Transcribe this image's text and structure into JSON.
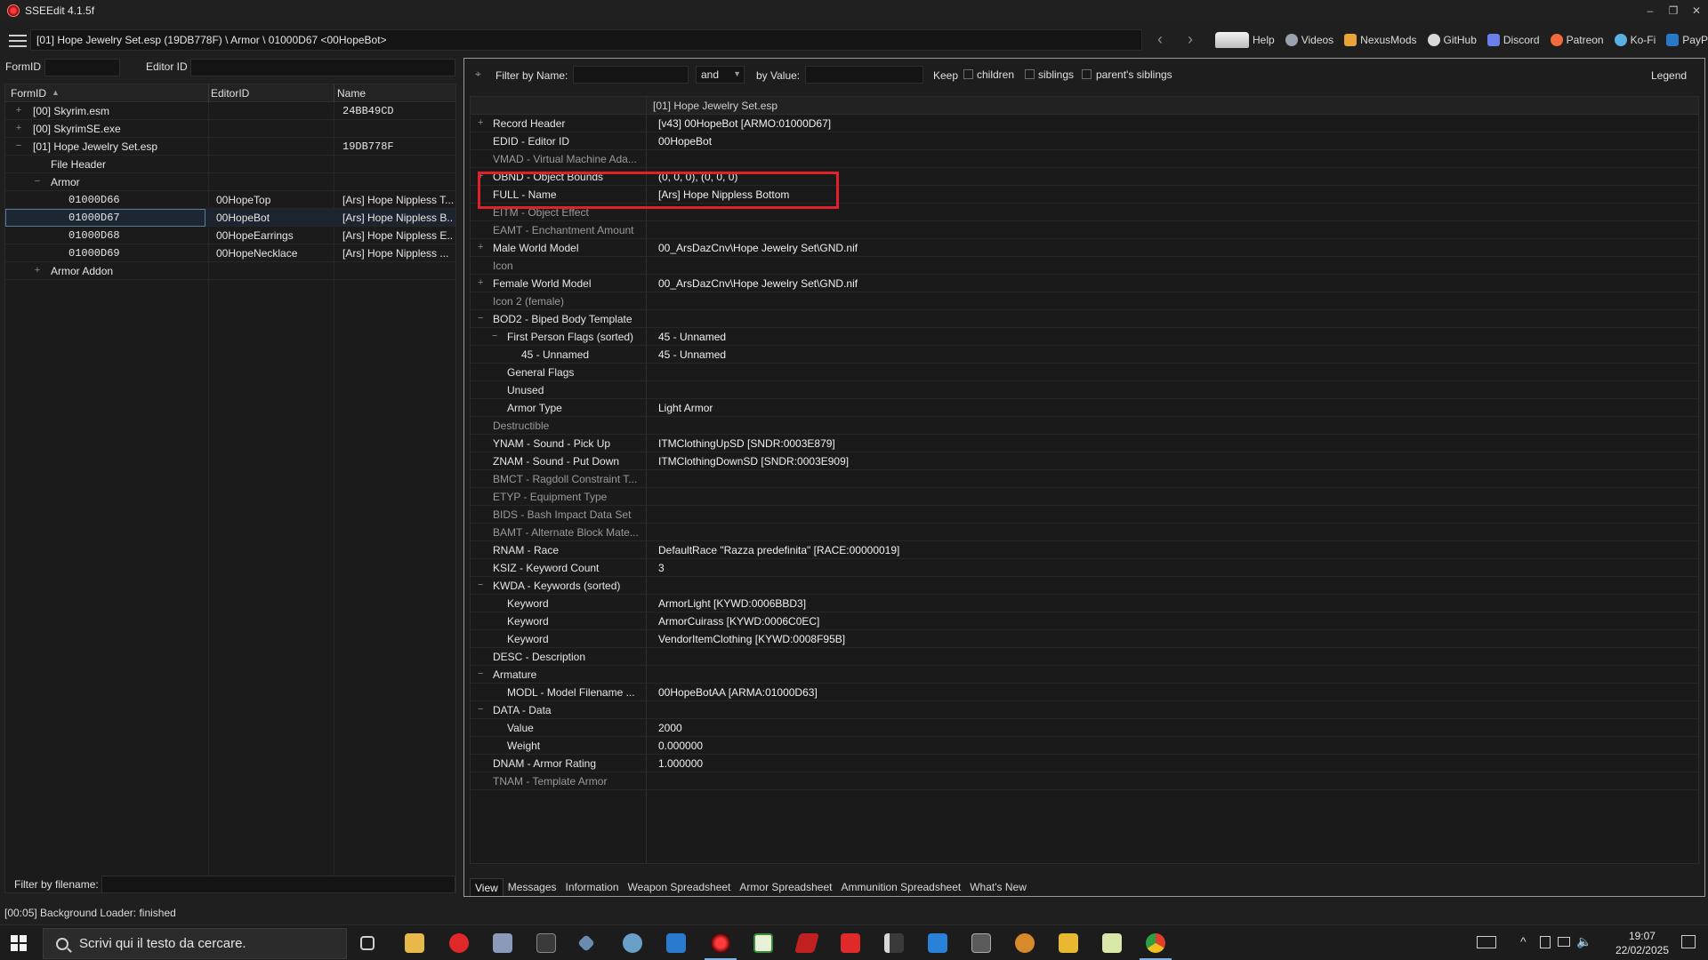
{
  "window": {
    "title": "SSEEdit 4.1.5f",
    "controls": [
      "–",
      "❐",
      "✕"
    ]
  },
  "pathbar": {
    "path": "[01] Hope Jewelry Set.esp (19DB778F) \\ Armor \\ 01000D67 <00HopeBot>",
    "links": [
      "Help",
      "Videos",
      "NexusMods",
      "GitHub",
      "Discord",
      "Patreon",
      "Ko-Fi",
      "PayPal"
    ]
  },
  "left": {
    "formid_label": "FormID",
    "editorid_label": "Editor ID",
    "columns": [
      "FormID",
      "EditorID",
      "Name"
    ],
    "rows": [
      {
        "exp": "+",
        "indent": 0,
        "formid": "[00] Skyrim.esm",
        "editorid": "",
        "name": "24BB49CD",
        "mono": false
      },
      {
        "exp": "+",
        "indent": 0,
        "formid": "[00] SkyrimSE.exe",
        "editorid": "",
        "name": "",
        "mono": false
      },
      {
        "exp": "−",
        "indent": 0,
        "formid": "[01] Hope Jewelry Set.esp",
        "editorid": "",
        "name": "19DB778F",
        "mono": false
      },
      {
        "exp": "",
        "indent": 1,
        "formid": "File Header",
        "editorid": "",
        "name": "",
        "mono": false
      },
      {
        "exp": "−",
        "indent": 1,
        "formid": "Armor",
        "editorid": "",
        "name": "",
        "mono": false
      },
      {
        "exp": "",
        "indent": 2,
        "formid": "01000D66",
        "editorid": "00HopeTop",
        "name": "[Ars] Hope Nippless T...",
        "mono": true
      },
      {
        "exp": "",
        "indent": 2,
        "formid": "01000D67",
        "editorid": "00HopeBot",
        "name": "[Ars] Hope Nippless B...",
        "mono": true,
        "selected": true
      },
      {
        "exp": "",
        "indent": 2,
        "formid": "01000D68",
        "editorid": "00HopeEarrings",
        "name": "[Ars] Hope Nippless E...",
        "mono": true
      },
      {
        "exp": "",
        "indent": 2,
        "formid": "01000D69",
        "editorid": "00HopeNecklace",
        "name": "[Ars] Hope Nippless ...",
        "mono": true
      },
      {
        "exp": "+",
        "indent": 1,
        "formid": "Armor Addon",
        "editorid": "",
        "name": "",
        "mono": false
      }
    ],
    "filter_filename_label": "Filter by filename:"
  },
  "right": {
    "filter_name_label": "Filter by Name:",
    "and_value": "and",
    "by_value_label": "by Value:",
    "keep_label": "Keep",
    "children_label": "children",
    "siblings_label": "siblings",
    "parents_siblings_label": "parent's siblings",
    "legend_label": "Legend",
    "grid_header": "[01] Hope Jewelry Set.esp",
    "rows": [
      {
        "exp": "+",
        "level": 0,
        "name": "Record Header",
        "value": "[v43] 00HopeBot [ARMO:01000D67]"
      },
      {
        "exp": "",
        "level": 0,
        "name": "EDID - Editor ID",
        "value": "00HopeBot"
      },
      {
        "exp": "",
        "level": 0,
        "name": "VMAD - Virtual Machine Ada...",
        "value": "",
        "dim": true
      },
      {
        "exp": "+",
        "level": 0,
        "name": "OBND - Object Bounds",
        "value": "(0, 0, 0), (0, 0, 0)"
      },
      {
        "exp": "",
        "level": 0,
        "name": "FULL - Name",
        "value": "[Ars] Hope Nippless Bottom"
      },
      {
        "exp": "",
        "level": 0,
        "name": "EITM - Object Effect",
        "value": "",
        "dim": true
      },
      {
        "exp": "",
        "level": 0,
        "name": "EAMT - Enchantment Amount",
        "value": "",
        "dim": true
      },
      {
        "exp": "+",
        "level": 0,
        "name": "Male World Model",
        "value": "00_ArsDazCnv\\Hope Jewelry Set\\GND.nif"
      },
      {
        "exp": "",
        "level": 0,
        "name": "Icon",
        "value": "",
        "dim": true
      },
      {
        "exp": "+",
        "level": 0,
        "name": "Female World Model",
        "value": "00_ArsDazCnv\\Hope Jewelry Set\\GND.nif"
      },
      {
        "exp": "",
        "level": 0,
        "name": "Icon 2 (female)",
        "value": "",
        "dim": true
      },
      {
        "exp": "−",
        "level": 0,
        "name": "BOD2 - Biped Body Template",
        "value": ""
      },
      {
        "exp": "−",
        "level": 1,
        "name": "First Person Flags (sorted)",
        "value": "45 - Unnamed"
      },
      {
        "exp": "",
        "level": 2,
        "name": "45 - Unnamed",
        "value": "45 - Unnamed"
      },
      {
        "exp": "",
        "level": 1,
        "name": "General Flags",
        "value": ""
      },
      {
        "exp": "",
        "level": 1,
        "name": "Unused",
        "value": ""
      },
      {
        "exp": "",
        "level": 1,
        "name": "Armor Type",
        "value": "Light Armor"
      },
      {
        "exp": "",
        "level": 0,
        "name": "Destructible",
        "value": "",
        "dim": true
      },
      {
        "exp": "",
        "level": 0,
        "name": "YNAM - Sound - Pick Up",
        "value": "ITMClothingUpSD [SNDR:0003E879]"
      },
      {
        "exp": "",
        "level": 0,
        "name": "ZNAM - Sound - Put Down",
        "value": "ITMClothingDownSD [SNDR:0003E909]"
      },
      {
        "exp": "",
        "level": 0,
        "name": "BMCT - Ragdoll Constraint T...",
        "value": "",
        "dim": true
      },
      {
        "exp": "",
        "level": 0,
        "name": "ETYP - Equipment Type",
        "value": "",
        "dim": true
      },
      {
        "exp": "",
        "level": 0,
        "name": "BIDS - Bash Impact Data Set",
        "value": "",
        "dim": true
      },
      {
        "exp": "",
        "level": 0,
        "name": "BAMT - Alternate Block Mate...",
        "value": "",
        "dim": true
      },
      {
        "exp": "",
        "level": 0,
        "name": "RNAM - Race",
        "value": "DefaultRace \"Razza predefinita\" [RACE:00000019]"
      },
      {
        "exp": "",
        "level": 0,
        "name": "KSIZ - Keyword Count",
        "value": "3"
      },
      {
        "exp": "−",
        "level": 0,
        "name": "KWDA - Keywords (sorted)",
        "value": ""
      },
      {
        "exp": "",
        "level": 1,
        "name": "Keyword",
        "value": "ArmorLight [KYWD:0006BBD3]"
      },
      {
        "exp": "",
        "level": 1,
        "name": "Keyword",
        "value": "ArmorCuirass [KYWD:0006C0EC]"
      },
      {
        "exp": "",
        "level": 1,
        "name": "Keyword",
        "value": "VendorItemClothing [KYWD:0008F95B]"
      },
      {
        "exp": "",
        "level": 0,
        "name": "DESC - Description",
        "value": ""
      },
      {
        "exp": "−",
        "level": 0,
        "name": "Armature",
        "value": ""
      },
      {
        "exp": "",
        "level": 1,
        "name": "MODL - Model Filename ...",
        "value": "00HopeBotAA [ARMA:01000D63]"
      },
      {
        "exp": "−",
        "level": 0,
        "name": "DATA - Data",
        "value": ""
      },
      {
        "exp": "",
        "level": 1,
        "name": "Value",
        "value": "2000"
      },
      {
        "exp": "",
        "level": 1,
        "name": "Weight",
        "value": "0.000000"
      },
      {
        "exp": "",
        "level": 0,
        "name": "DNAM - Armor Rating",
        "value": "1.000000"
      },
      {
        "exp": "",
        "level": 0,
        "name": "TNAM - Template Armor",
        "value": "",
        "dim": true
      }
    ],
    "tabs": [
      "View",
      "Messages",
      "Information",
      "Weapon Spreadsheet",
      "Armor Spreadsheet",
      "Ammunition Spreadsheet",
      "What's New"
    ],
    "active_tab": "View"
  },
  "status": "[00:05] Background Loader: finished",
  "taskbar": {
    "search_placeholder": "Scrivi qui il testo da cercare.",
    "time": "19:07",
    "date": "22/02/2025"
  },
  "colors": {
    "highlight": "#e0202a",
    "selection": "#1c2733"
  }
}
